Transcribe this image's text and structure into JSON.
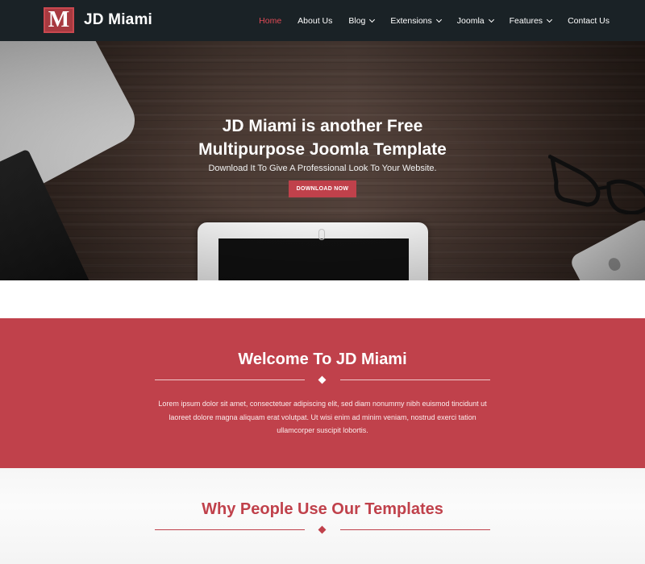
{
  "brand": {
    "logo_letter": "M",
    "name": "JD Miami"
  },
  "nav": {
    "home": "Home",
    "about": "About Us",
    "blog": "Blog",
    "extensions": "Extensions",
    "joomla": "Joomla",
    "features": "Features",
    "contact": "Contact Us"
  },
  "hero": {
    "title": "JD Miami is another Free Multipurpose Joomla Template",
    "subtitle": "Download It To Give A Professional Look To Your Website.",
    "button": "DOWNLOAD NOW"
  },
  "welcome": {
    "title": "Welcome To JD Miami",
    "text": "Lorem ipsum dolor sit amet, consectetuer adipiscing elit, sed diam nonummy nibh euismod tincidunt ut laoreet dolore magna aliquam erat volutpat. Ut wisi enim ad minim veniam, nostrud exerci tation ullamcorper suscipit lobortis."
  },
  "why": {
    "title": "Why People Use Our Templates"
  },
  "colors": {
    "accent": "#c0414b",
    "header_bg": "#1a2226",
    "active_nav": "#e04a55"
  },
  "icons": {
    "dropdown": "chevron-down-icon",
    "divider": "diamond-icon"
  }
}
